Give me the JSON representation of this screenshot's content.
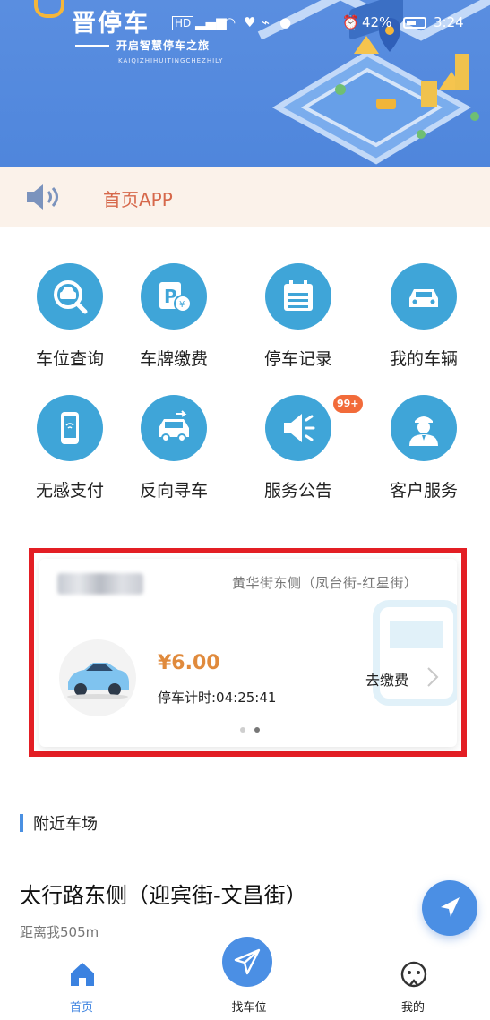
{
  "header": {
    "app_title": "晋停车",
    "slogan": "开启智慧停车之旅",
    "pinyin": "KAIQIZHIHUITINGCHEZHILY"
  },
  "status_bar": {
    "battery": "42%",
    "time": "3:24"
  },
  "notice": {
    "text": "首页APP"
  },
  "services": [
    {
      "label": "车位查询",
      "icon": "car-search-icon"
    },
    {
      "label": "车牌缴费",
      "icon": "plate-payment-icon"
    },
    {
      "label": "停车记录",
      "icon": "parking-record-icon"
    },
    {
      "label": "我的车辆",
      "icon": "my-car-icon"
    },
    {
      "label": "无感支付",
      "icon": "contactless-pay-icon"
    },
    {
      "label": "反向寻车",
      "icon": "reverse-find-car-icon"
    },
    {
      "label": "服务公告",
      "icon": "announcement-icon"
    },
    {
      "label": "客户服务",
      "icon": "customer-service-icon"
    }
  ],
  "announcement_badge": "99+",
  "parking_card": {
    "location": "黄华街东侧（凤台街-红星街）",
    "fee": "¥6.00",
    "duration": "停车计时:04:25:41",
    "pay_label": "去缴费",
    "page_count": 2,
    "active_page": 1
  },
  "nearby": {
    "section_title": "附近车场",
    "lot_name": "太行路东侧（迎宾街-文昌街）",
    "distance": "距离我505m"
  },
  "tabbar": {
    "home": "首页",
    "find": "找车位",
    "mine": "我的"
  },
  "colors": {
    "primary": "#4b8fe4",
    "icon_circle": "#3fa5d8",
    "notice_bg": "#fbf2ea",
    "notice_text": "#d6684b",
    "fee": "#e08a3c",
    "highlight_border": "#e31e24",
    "badge": "#f26b3a"
  }
}
